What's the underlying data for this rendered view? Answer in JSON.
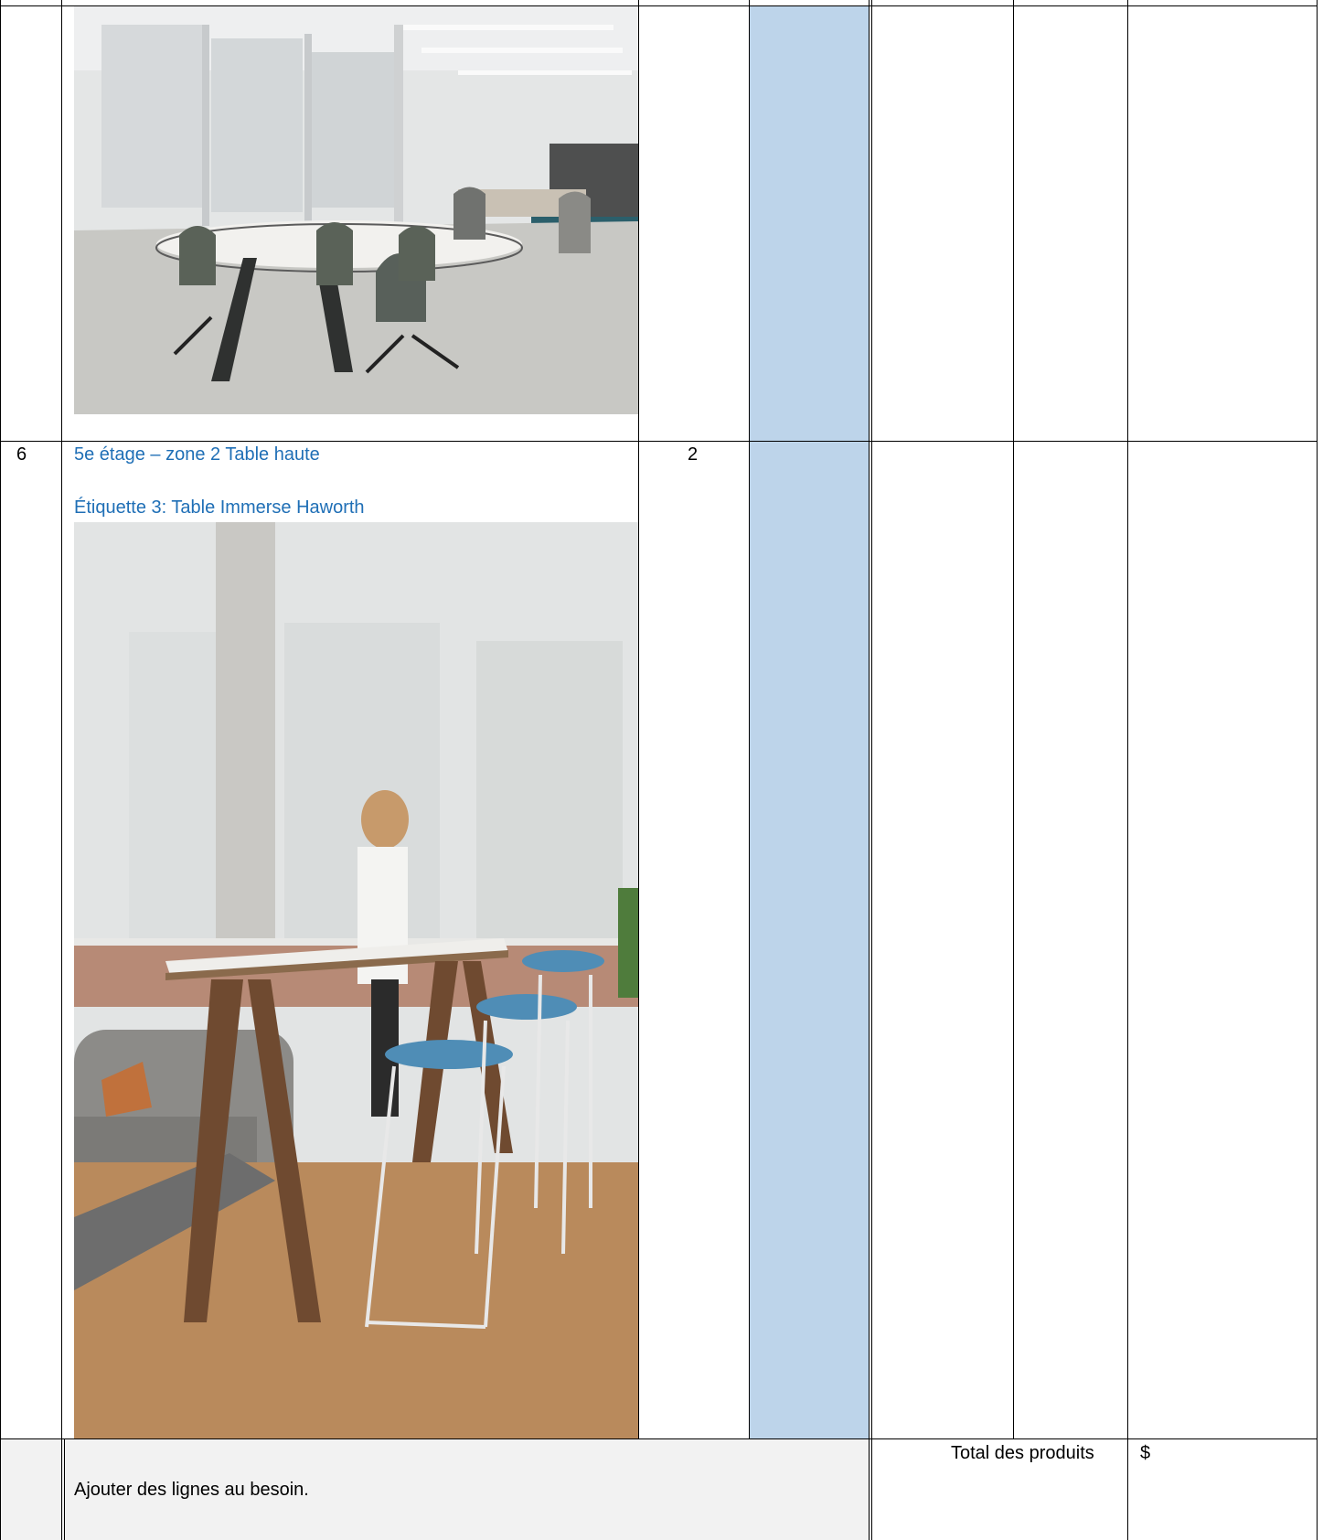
{
  "rows": [
    {
      "number": "",
      "image_name": "office-meeting-room-photo"
    },
    {
      "number": "6",
      "line1": "5e étage – zone 2 Table haute",
      "line2": "Étiquette 3: Table Immerse Haworth",
      "quantity": "2",
      "image_name": "high-table-photo"
    }
  ],
  "footer": {
    "note": "Ajouter des lignes au besoin.",
    "total_label": "Total des produits",
    "total_value": "$"
  },
  "colors": {
    "price_column_fill": "#bdd4ea",
    "footer_fill": "#f2f2f2",
    "link_text": "#1f6fb6"
  }
}
